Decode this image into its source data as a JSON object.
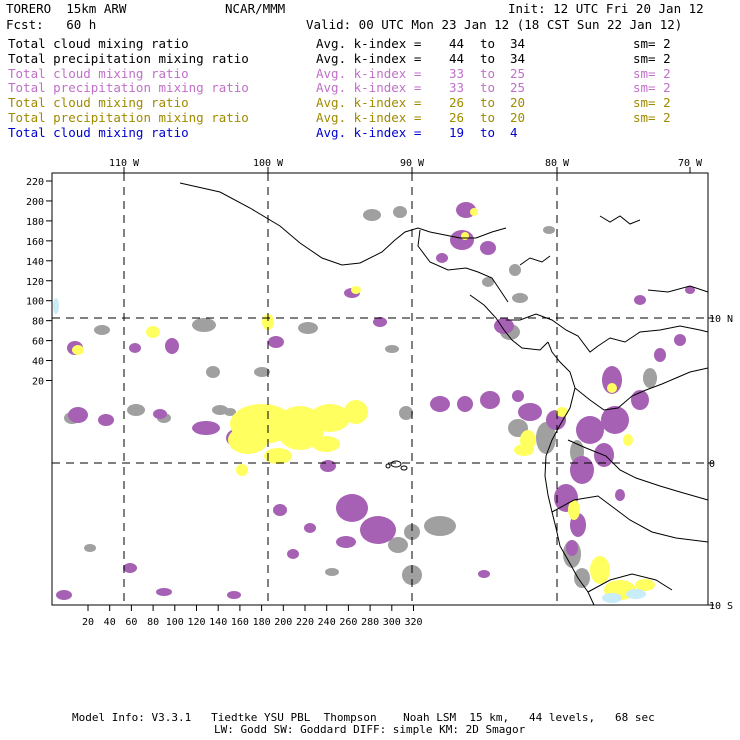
{
  "header": {
    "model": "TORERO  15km ARW",
    "org": "NCAR/MMM",
    "init": "Init: 12 UTC Fri 20 Jan 12",
    "fcst": "Fcst:   60 h",
    "valid": "Valid: 00 UTC Mon 23 Jan 12 (18 CST Sun 22 Jan 12)"
  },
  "legend": [
    {
      "field": "Total cloud mixing ratio",
      "kindex": "Avg. k-index =",
      "from": "44",
      "to_word": "to",
      "to": "34",
      "sm": "sm= 2",
      "color": "#000000"
    },
    {
      "field": "Total precipitation mixing ratio",
      "kindex": "Avg. k-index =",
      "from": "44",
      "to_word": "to",
      "to": "34",
      "sm": "sm= 2",
      "color": "#000000"
    },
    {
      "field": "Total cloud mixing ratio",
      "kindex": "Avg. k-index =",
      "from": "33",
      "to_word": "to",
      "to": "25",
      "sm": "sm= 2",
      "color": "#c070c8"
    },
    {
      "field": "Total precipitation mixing ratio",
      "kindex": "Avg. k-index =",
      "from": "33",
      "to_word": "to",
      "to": "25",
      "sm": "sm= 2",
      "color": "#c070c8"
    },
    {
      "field": "Total cloud mixing ratio",
      "kindex": "Avg. k-index =",
      "from": "26",
      "to_word": "to",
      "to": "20",
      "sm": "sm= 2",
      "color": "#a08a00"
    },
    {
      "field": "Total precipitation mixing ratio",
      "kindex": "Avg. k-index =",
      "from": "26",
      "to_word": "to",
      "to": "20",
      "sm": "sm= 2",
      "color": "#a08a00"
    },
    {
      "field": "Total cloud mixing ratio",
      "kindex": "Avg. k-index =",
      "from": "19",
      "to_word": "to",
      "to": "4",
      "sm": "",
      "color": "#0000d0"
    }
  ],
  "map": {
    "top_lon_labels": [
      "110 W",
      "100 W",
      "90 W",
      "80 W",
      "70 W"
    ],
    "right_lat_labels": [
      "10 N",
      "0",
      "10 S"
    ],
    "y_ticks": [
      "220",
      "200",
      "180",
      "160",
      "140",
      "120",
      "100",
      "80",
      "60",
      "40",
      "20"
    ],
    "x_ticks": [
      "20",
      "40",
      "60",
      "80",
      "100",
      "120",
      "140",
      "160",
      "180",
      "200",
      "220",
      "240",
      "260",
      "280",
      "300",
      "320"
    ],
    "colors": {
      "gray": "#a0a0a0",
      "purple": "#a660b4",
      "yellow": "#ffff60",
      "cyan": "#c8ecf8"
    }
  },
  "footer": {
    "line1": "Model Info: V3.3.1   Tiedtke YSU PBL  Thompson    Noah LSM  15 km,   44 levels,   68 sec",
    "line2": "LW: Godd SW: Goddard DIFF: simple KM: 2D Smagor"
  }
}
